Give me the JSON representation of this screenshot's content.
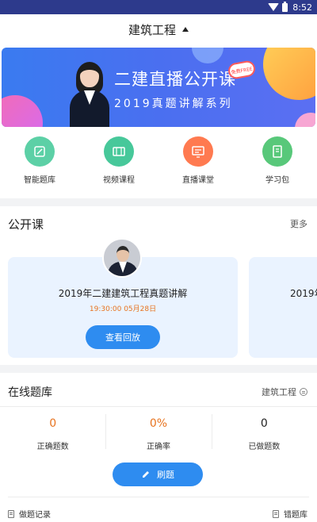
{
  "statusbar": {
    "time": "8:52"
  },
  "topbar": {
    "title": "建筑工程"
  },
  "banner": {
    "headline": "二建直播公开课",
    "subline": "2019真题讲解系列",
    "badge": "免费FREE"
  },
  "nav": {
    "items": [
      {
        "label": "智能题库",
        "icon": "pencil-icon",
        "color": "#5cd0a6"
      },
      {
        "label": "视频课程",
        "icon": "film-icon",
        "color": "#47c89a"
      },
      {
        "label": "直播课堂",
        "icon": "monitor-icon",
        "color": "#ff7a50"
      },
      {
        "label": "学习包",
        "icon": "notebook-icon",
        "color": "#58c87a"
      }
    ]
  },
  "course": {
    "title": "公开课",
    "more": "更多",
    "card": {
      "title": "2019年二建建筑工程真题讲解",
      "time": "19:30:00 05月28日",
      "button": "查看回放"
    },
    "next_card": {
      "title": "2019年"
    }
  },
  "bank": {
    "title": "在线题库",
    "subject": "建筑工程",
    "stats": [
      {
        "value": "0",
        "label": "正确题数",
        "color": "#e7731f"
      },
      {
        "value": "0%",
        "label": "正确率",
        "color": "#e7731f"
      },
      {
        "value": "0",
        "label": "已做题数",
        "color": "#222222"
      }
    ],
    "button": "刷题",
    "footer_left": "做题记录",
    "footer_right": "错题库"
  },
  "colors": {
    "accent": "#2e8cf0",
    "statusbar": "#2d3a8c",
    "highlight": "#e7731f"
  }
}
